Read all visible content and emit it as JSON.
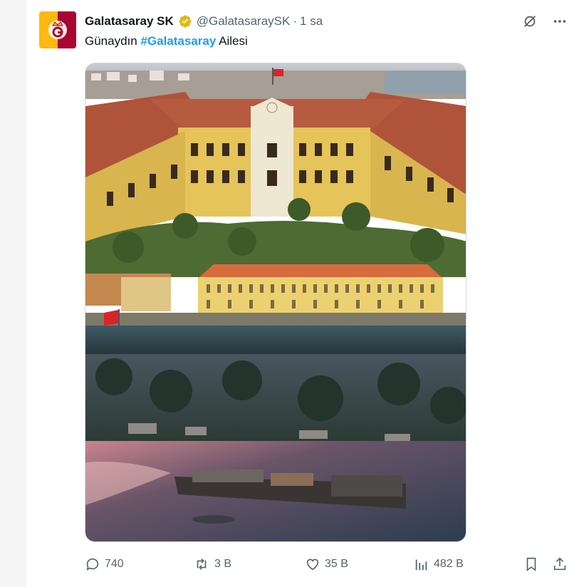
{
  "post": {
    "display_name": "Galatasaray SK",
    "handle": "@GalatasaraySK",
    "separator": "·",
    "time": "1 sa",
    "text_before": "Günaydın ",
    "hashtag": "#Galatasaray",
    "text_after": " Ailesi"
  },
  "icons": {
    "avatar": "galatasaray-crest",
    "verified": "verified-badge-icon",
    "grok": "grok-icon",
    "more": "more-icon"
  },
  "actions": {
    "replies": "740",
    "reposts": "3 B",
    "likes": "35 B",
    "views": "482 B"
  },
  "colors": {
    "accent": "#1d9bf0",
    "badge_gold": "#e2b719",
    "club_red": "#a90432",
    "club_yellow": "#fdb912"
  }
}
